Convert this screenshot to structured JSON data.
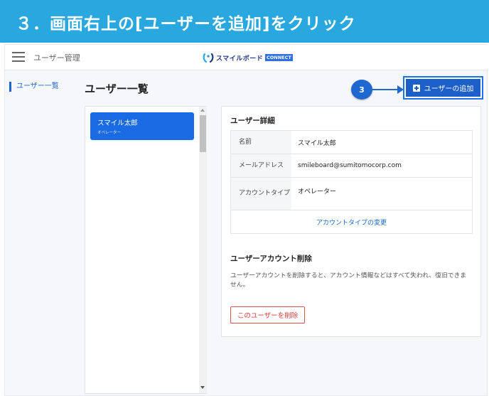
{
  "banner": {
    "text": "３．画面右上の[ユーザーを追加]をクリック"
  },
  "topbar": {
    "app_title": "ユーザー管理",
    "logo_text": "スマイルボード",
    "logo_badge": "CONNECT"
  },
  "sidebar": {
    "items": [
      {
        "label": "ユーザー一覧",
        "active": true
      }
    ]
  },
  "main": {
    "page_title": "ユーザー一覧",
    "add_button_label": "ユーザーの追加",
    "step_badge": "3"
  },
  "user_list": {
    "items": [
      {
        "name": "スマイル太郎",
        "role": "オペレーター",
        "selected": true
      }
    ]
  },
  "user_detail": {
    "title": "ユーザー詳細",
    "rows": [
      {
        "label": "名前",
        "value": "スマイル太郎"
      },
      {
        "label": "メールアドレス",
        "value": "smileboard@sumitomocorp.com"
      },
      {
        "label": "アカウントタイプ",
        "value": "オペレーター"
      }
    ],
    "change_type_link": "アカウントタイプの変更"
  },
  "delete_section": {
    "title": "ユーザーアカウント削除",
    "description": "ユーザーアカウントを削除すると、アカウント情報などはすべて失われ、復旧できません。",
    "delete_button": "このユーザーを削除"
  },
  "colors": {
    "banner": "#29a8df",
    "primary": "#1a6be3",
    "danger": "#d93c3c"
  }
}
